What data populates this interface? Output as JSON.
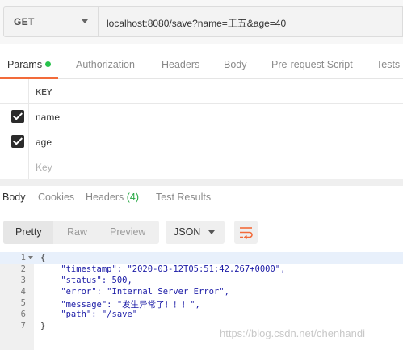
{
  "request": {
    "method": "GET",
    "url": "localhost:8080/save?name=王五&age=40"
  },
  "request_tabs": [
    {
      "label": "Params",
      "active": true,
      "has_dot": true
    },
    {
      "label": "Authorization"
    },
    {
      "label": "Headers"
    },
    {
      "label": "Body"
    },
    {
      "label": "Pre-request Script"
    },
    {
      "label": "Tests"
    }
  ],
  "params": {
    "header_key": "KEY",
    "rows": [
      {
        "key": "name",
        "checked": true
      },
      {
        "key": "age",
        "checked": true
      }
    ],
    "placeholder": "Key"
  },
  "response_tabs": [
    {
      "label": "Body",
      "active": true
    },
    {
      "label": "Cookies"
    },
    {
      "label": "Headers",
      "count": "(4)"
    },
    {
      "label": "Test Results"
    }
  ],
  "view_buttons": [
    "Pretty",
    "Raw",
    "Preview"
  ],
  "format": "JSON",
  "wrap_icon": "wrap-lines-icon",
  "code": {
    "line_numbers": [
      "1",
      "2",
      "3",
      "4",
      "5",
      "6",
      "7"
    ],
    "lines": [
      "{",
      "    \"timestamp\": \"2020-03-12T05:51:42.267+0000\",",
      "    \"status\": 500,",
      "    \"error\": \"Internal Server Error\",",
      "    \"message\": \"发生异常了！！！\",",
      "    \"path\": \"/save\"",
      "}"
    ]
  },
  "watermark": "https://blog.csdn.net/chenhandi",
  "colors": {
    "accent": "#f26b3a",
    "success": "#27c24c"
  }
}
